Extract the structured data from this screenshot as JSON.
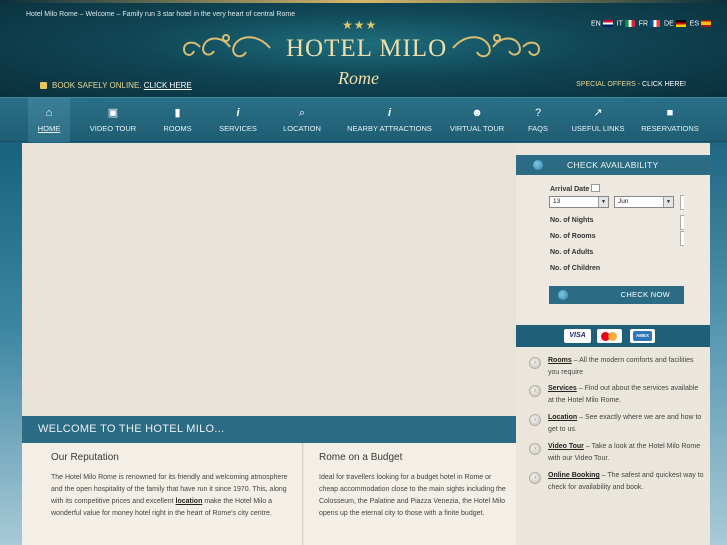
{
  "header": {
    "tagline": "Hotel Milo Rome – Welcome – Family run 3 star hotel in the very heart of central Rome",
    "stars": "★★★",
    "logo_title": "HOTEL MILO",
    "logo_subtitle": "Rome",
    "book_text": "BOOK SAFELY ONLINE.",
    "book_link": "CLICK HERE",
    "special_text": "SPECIAL OFFERS -",
    "special_link": "CLICK HERE!",
    "languages": [
      {
        "code": "EN",
        "icon": "flag-uk-icon"
      },
      {
        "code": "IT",
        "icon": "flag-italy-icon"
      },
      {
        "code": "FR",
        "icon": "flag-france-icon"
      },
      {
        "code": "DE",
        "icon": "flag-germany-icon"
      },
      {
        "code": "ES",
        "icon": "flag-spain-icon"
      }
    ]
  },
  "nav": {
    "items": [
      {
        "label": "HOME",
        "icon": "home-icon",
        "glyph": "⌂",
        "active": true
      },
      {
        "label": "VIDEO TOUR",
        "icon": "video-camera-icon",
        "glyph": "▣"
      },
      {
        "label": "ROOMS",
        "icon": "door-icon",
        "glyph": "▮"
      },
      {
        "label": "SERVICES",
        "icon": "info-icon",
        "glyph": "i"
      },
      {
        "label": "LOCATION",
        "icon": "magnifier-icon",
        "glyph": "⌕"
      },
      {
        "label": "NEARBY ATTRACTIONS",
        "icon": "info-icon",
        "glyph": "i"
      },
      {
        "label": "VIRTUAL TOUR",
        "icon": "person-icon",
        "glyph": "☻"
      },
      {
        "label": "FAQS",
        "icon": "question-icon",
        "glyph": "?"
      },
      {
        "label": "USEFUL LINKS",
        "icon": "link-icon",
        "glyph": "↗"
      },
      {
        "label": "RESERVATIONS",
        "icon": "lock-icon",
        "glyph": "■"
      }
    ]
  },
  "main": {
    "welcome_title": "WELCOME TO THE HOTEL MILO...",
    "reputation": {
      "title": "Our Reputation",
      "text_before": "The Hotel Milo Rome is renowned for its friendly and welcoming atmosphere and the open hospitality of the family that have run it since 1970. This, along with its competitive prices and excellent",
      "link": "location",
      "text_after": "make the Hotel Milo a wonderful value for money hotel right in the heart of Rome's city centre."
    },
    "budget": {
      "title": "Rome on a Budget",
      "text": "Ideal for travellers looking for a budget hotel in Rome or cheap accommodation close to the main sights including the Colosseum, the Palatine and Piazza Venezia, the Hotel Milo opens up the eternal city to those with a finite budget."
    }
  },
  "availability": {
    "title": "CHECK AVAILABILITY",
    "arrival_label": "Arrival Date",
    "day_value": "13",
    "month_value": "Jun",
    "nights_label": "No. of Nights",
    "rooms_label": "No. of Rooms",
    "adults_label": "No. of Adults",
    "children_label": "No. of Children",
    "button": "CHECK NOW"
  },
  "cards": {
    "visa": "VISA",
    "amex": "AMEX"
  },
  "sidebar_links": [
    {
      "link": "Rooms",
      "text": " – All the modern comforts and facilities you require"
    },
    {
      "link": "Services",
      "text": " – Find out about the services available at the Hotel Milo Rome."
    },
    {
      "link": "Location",
      "text": " – See exactly where we are and how to get to us."
    },
    {
      "link": "Video Tour",
      "text": " – Take a look at the Hotel Milo Rome with our Video Tour."
    },
    {
      "link": "Online Booking",
      "text": " – The safest and quickest way to check for availability and book."
    }
  ],
  "colors": {
    "nav_bg": "#1f5e74",
    "accent_gold": "#f0dfae",
    "panel_bg": "#e9e4da"
  }
}
